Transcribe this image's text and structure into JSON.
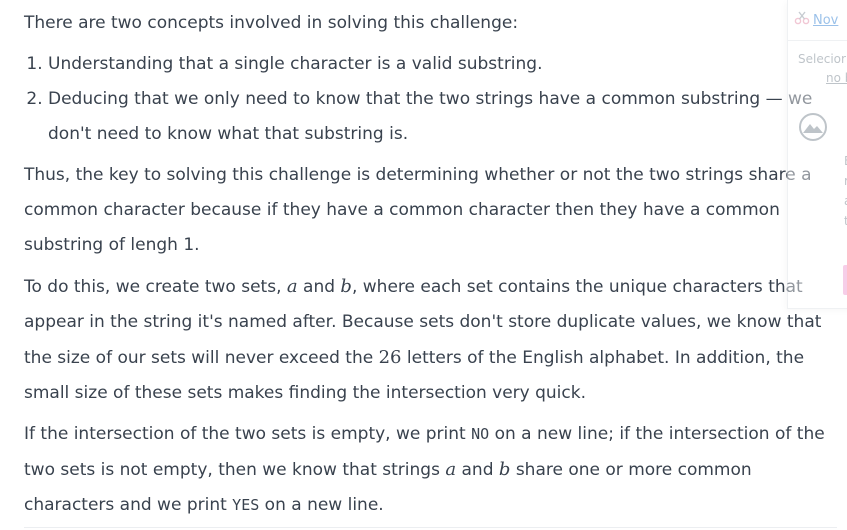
{
  "intro": "There are two concepts involved in solving this challenge:",
  "concepts": [
    "Understanding that a single character is a valid substring.",
    "Deducing that we only need to know that the two strings have a common substring — we don't need to know what that substring is."
  ],
  "para_key": "Thus, the key to solving this challenge is determining whether or not the two strings share a common character because if they have a common character then they have a common substring of lengh 1.",
  "para_sets": {
    "p1": "To do this, we create two sets,",
    "var_a": "a",
    "p2": "and",
    "var_b": "b",
    "p3": ", where each set contains the unique characters that appear in the string it's named after. Because sets don't store duplicate values, we know that the size of our sets will never exceed the",
    "num": "26",
    "p4": "letters of the English alphabet. In addition, the small size of these sets makes finding the intersection very quick."
  },
  "para_result": {
    "p1": "If the intersection of the two sets is empty, we print",
    "code_no": "NO",
    "p2": "on a new line; if the intersection of the two sets is not empty, then we know that strings",
    "var_a": "a",
    "p3": "and",
    "var_b": "b",
    "p4": "share one or more common characters and we print",
    "code_yes": "YES",
    "p5": "on a new line."
  },
  "overlay": {
    "new_label": "Nov",
    "select_text": "Selecior",
    "select_text2": "no botã",
    "letters": [
      "E",
      "r",
      "a",
      "t"
    ]
  },
  "colors": {
    "text": "#39424e",
    "link": "#4a8fd8",
    "pink": "#f0a7d6"
  }
}
